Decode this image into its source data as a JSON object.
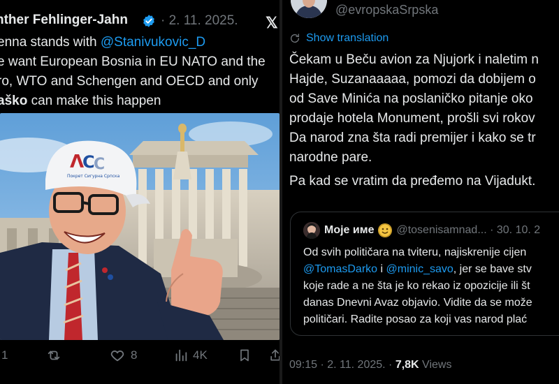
{
  "left_tweet": {
    "author": "nther Fehlinger-Jahn",
    "date": "· 2. 11. 2025.",
    "text_lines": [
      [
        "enna stands with ",
        "@Stanivukovic_D"
      ],
      [
        "e want European Bosnia in EU NATO and the"
      ],
      [
        "ro, WTO and Schengen and OECD and only"
      ],
      [
        "aško",
        " can make this happen"
      ]
    ],
    "line1_plain": "enna stands with ",
    "line1_mention": "@Stanivukovic_D",
    "line2": "e want European Bosnia in EU NATO and the",
    "line3": "ro, WTO and Schengen and OECD and only",
    "line4_bold": "aško",
    "line4_rest": " can make this happen",
    "cap_text": "Покрет Сигурна Српска",
    "actions": {
      "replies": "1",
      "likes": "8",
      "views": "4K"
    }
  },
  "right_tweet": {
    "handle": "@evropskaSrpska",
    "show_translation": "Show translation",
    "text_lines": [
      "Čekam u Beču avion za Njujork i naletim n",
      "Hajde, Suzanaaaaa, pomozi da dobijem o",
      "od Save Minića na poslaničko pitanje oko",
      "prodaje hotela Monument, prošli svi rokov",
      "Da narod zna šta radi premijer i kako se tr",
      "narodne pare.",
      "Pa kad se vratim da pređemo na Vijadukt."
    ],
    "quote": {
      "name": "Моје име",
      "handle": "@tosenisamnad... · 30. 10. 2",
      "lines": [
        [
          "Od svih političara na tviteru, najiskrenije cijen"
        ],
        [
          "@TomasDarko",
          " i ",
          "@minic_savo",
          ", jer se bave stv"
        ],
        [
          "koje rade a ne šta je ko rekao iz opozicije ili št"
        ],
        [
          "danas Dnevni Avaz objavio. Vidite da se može"
        ],
        [
          "političari. Radite posao za koji vas narod plać"
        ]
      ],
      "line1": "Od svih političara na tviteru, najiskrenije cijen",
      "line2_m1": "@TomasDarko",
      "line2_mid": " i ",
      "line2_m2": "@minic_savo",
      "line2_rest": ", jer se bave stv",
      "line3": "koje rade a ne šta je ko rekao iz opozicije ili št",
      "line4": "danas Dnevni Avaz objavio. Vidite da se može",
      "line5": "političari. Radite posao za koji vas narod plać"
    },
    "meta_time": "09:15 · 2. 11. 2025. · ",
    "meta_views_num": "7,8K",
    "meta_views_label": " Views"
  },
  "colors": {
    "background": "#000000",
    "text": "#e7e9ea",
    "muted": "#71767b",
    "accent": "#1d9bf0",
    "verified_badge": "#1d9bf0"
  },
  "icons": [
    "verified-badge-icon",
    "x-logo-icon",
    "reply-icon",
    "retweet-icon",
    "like-icon",
    "views-icon",
    "bookmark-icon",
    "share-icon",
    "translate-icon",
    "smiley-emoji-icon"
  ]
}
